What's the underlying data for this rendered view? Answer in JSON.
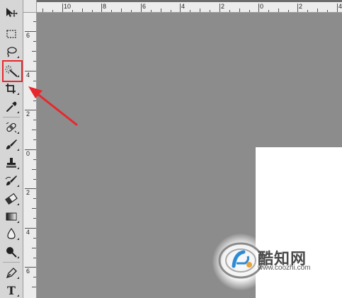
{
  "rulers": {
    "top_ticks": [
      "10",
      "8",
      "6",
      "4",
      "2",
      "0",
      "2",
      "4"
    ],
    "left_ticks": [
      "6",
      "4",
      "2",
      "0",
      "2",
      "4",
      "6"
    ]
  },
  "toolbar": {
    "tools": [
      {
        "icon": "move-icon"
      },
      {
        "icon": "rectangular-marquee-icon"
      },
      {
        "icon": "lasso-icon"
      },
      {
        "icon": "magic-wand-icon",
        "highlighted": true
      },
      {
        "icon": "crop-icon"
      },
      {
        "icon": "eyedropper-icon"
      },
      {
        "icon": "spot-healing-brush-icon"
      },
      {
        "icon": "brush-icon"
      },
      {
        "icon": "clone-stamp-icon"
      },
      {
        "icon": "history-brush-icon"
      },
      {
        "icon": "eraser-icon"
      },
      {
        "icon": "gradient-icon"
      },
      {
        "icon": "blur-icon"
      },
      {
        "icon": "dodge-icon"
      },
      {
        "icon": "pen-icon"
      },
      {
        "icon": "type-icon"
      }
    ],
    "type_tool_glyph": "T"
  },
  "annotation": {
    "color": "#e8272c"
  },
  "watermark": {
    "name": "酷知网",
    "url": "www.coozhi.com"
  },
  "colors": {
    "workspace": "#8c8c8c",
    "toolbar": "#d6d6d6",
    "ruler": "#ececec"
  }
}
